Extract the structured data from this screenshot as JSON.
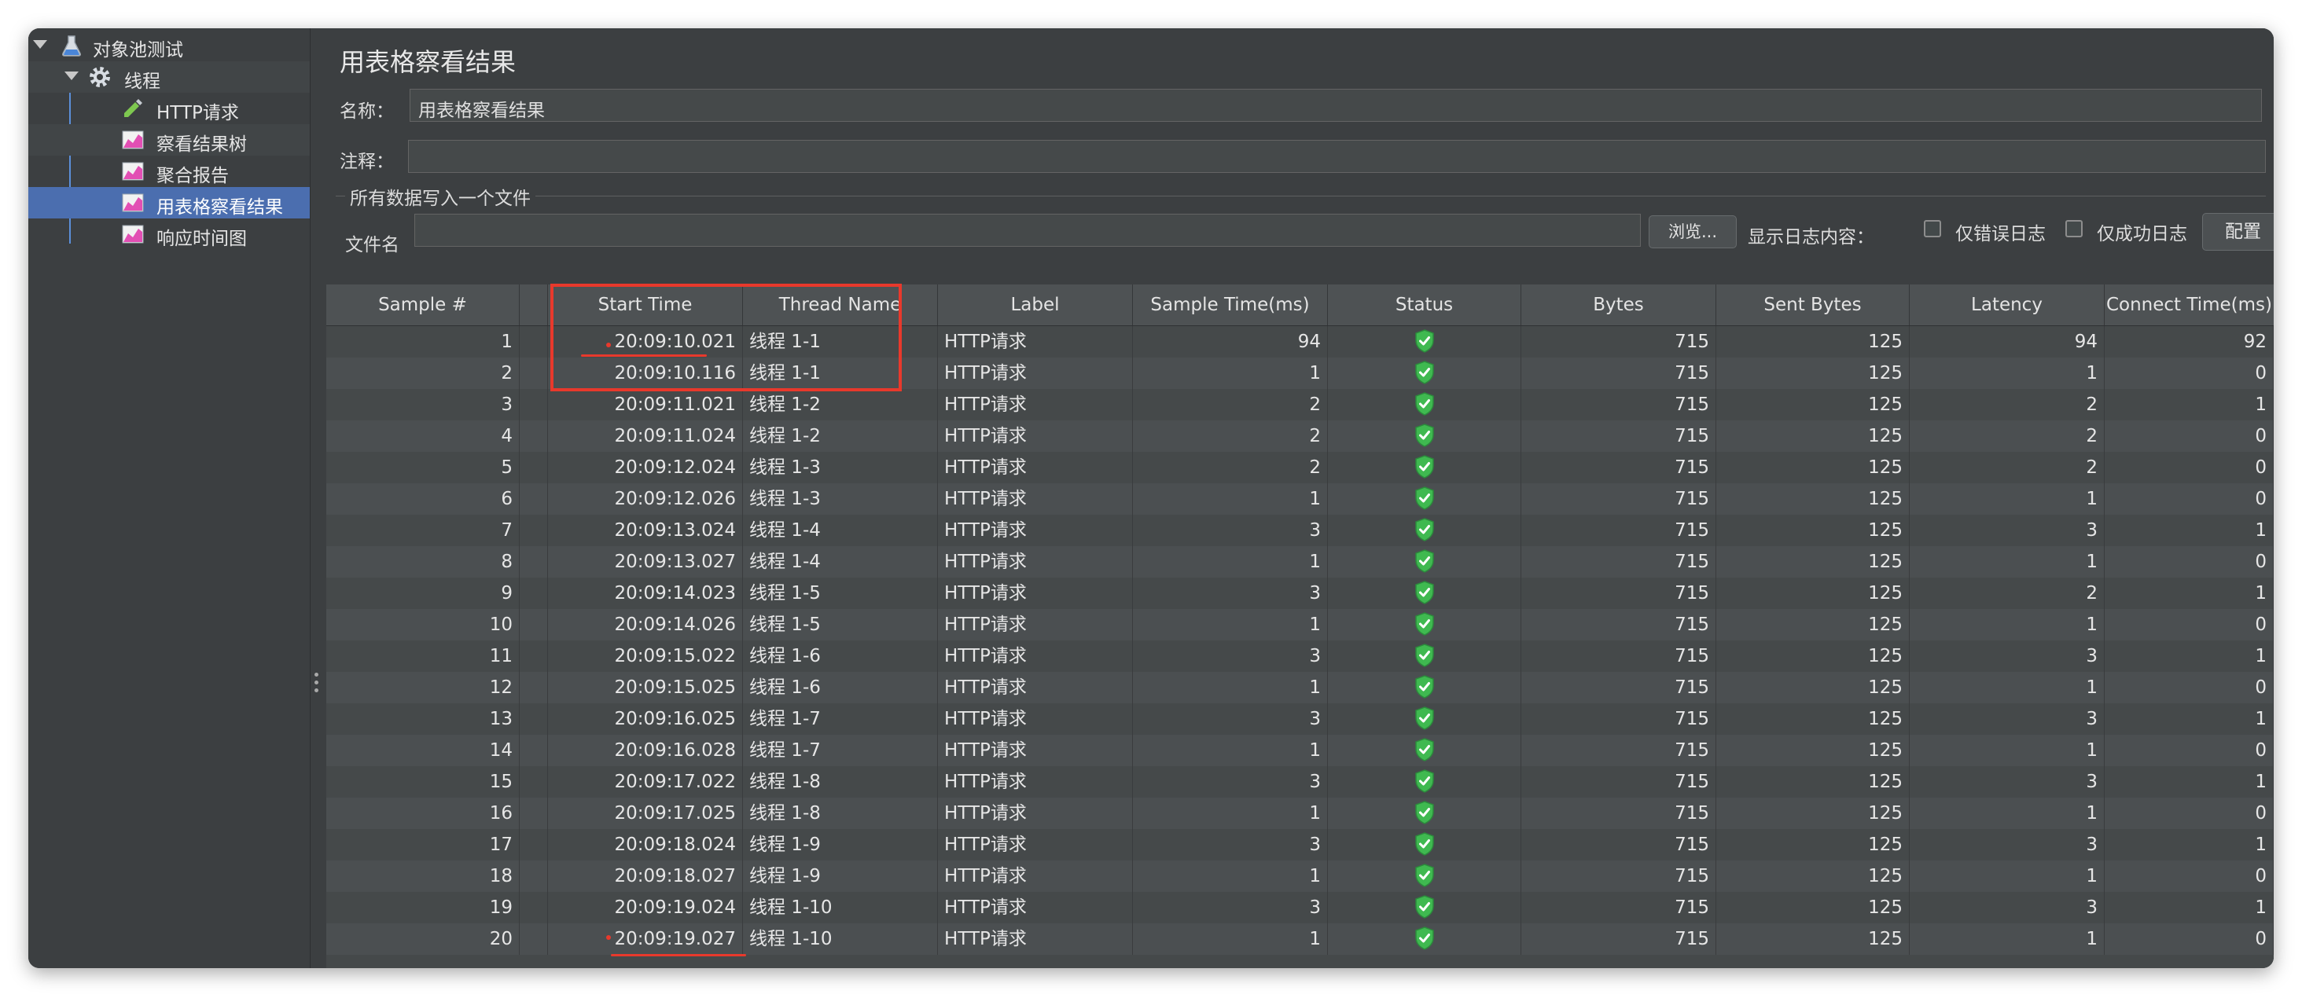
{
  "sidebar": {
    "items": [
      {
        "label": "对象池测试",
        "icon": "flask-icon"
      },
      {
        "label": "线程",
        "icon": "gear-icon"
      },
      {
        "label": "HTTP请求",
        "icon": "pipette-icon"
      },
      {
        "label": "察看结果树",
        "icon": "chart-icon"
      },
      {
        "label": "聚合报告",
        "icon": "chart-icon"
      },
      {
        "label": "用表格察看结果",
        "icon": "chart-icon"
      },
      {
        "label": "响应时间图",
        "icon": "chart-icon"
      }
    ]
  },
  "panel": {
    "title": "用表格察看结果",
    "name_label": "名称：",
    "name_value": "用表格察看结果",
    "comment_label": "注释：",
    "comment_value": "",
    "group_title": "所有数据写入一个文件",
    "filename_label": "文件名",
    "filename_value": "",
    "browse_button": "浏览...",
    "log_content_label": "显示日志内容：",
    "errors_only_label": "仅错误日志",
    "success_only_label": "仅成功日志",
    "configure_button": "配置"
  },
  "table": {
    "columns": [
      "Sample #",
      "Start Time",
      "Thread Name",
      "Label",
      "Sample Time(ms)",
      "Status",
      "Bytes",
      "Sent Bytes",
      "Latency",
      "Connect Time(ms)"
    ],
    "rows": [
      {
        "sample": "1",
        "start": "20:09:10.021",
        "thread": "线程 1-1",
        "label": "HTTP请求",
        "time": "94",
        "status": "success",
        "bytes": "715",
        "sent": "125",
        "latency": "94",
        "connect": "92"
      },
      {
        "sample": "2",
        "start": "20:09:10.116",
        "thread": "线程 1-1",
        "label": "HTTP请求",
        "time": "1",
        "status": "success",
        "bytes": "715",
        "sent": "125",
        "latency": "1",
        "connect": "0"
      },
      {
        "sample": "3",
        "start": "20:09:11.021",
        "thread": "线程 1-2",
        "label": "HTTP请求",
        "time": "2",
        "status": "success",
        "bytes": "715",
        "sent": "125",
        "latency": "2",
        "connect": "1"
      },
      {
        "sample": "4",
        "start": "20:09:11.024",
        "thread": "线程 1-2",
        "label": "HTTP请求",
        "time": "2",
        "status": "success",
        "bytes": "715",
        "sent": "125",
        "latency": "2",
        "connect": "0"
      },
      {
        "sample": "5",
        "start": "20:09:12.024",
        "thread": "线程 1-3",
        "label": "HTTP请求",
        "time": "2",
        "status": "success",
        "bytes": "715",
        "sent": "125",
        "latency": "2",
        "connect": "0"
      },
      {
        "sample": "6",
        "start": "20:09:12.026",
        "thread": "线程 1-3",
        "label": "HTTP请求",
        "time": "1",
        "status": "success",
        "bytes": "715",
        "sent": "125",
        "latency": "1",
        "connect": "0"
      },
      {
        "sample": "7",
        "start": "20:09:13.024",
        "thread": "线程 1-4",
        "label": "HTTP请求",
        "time": "3",
        "status": "success",
        "bytes": "715",
        "sent": "125",
        "latency": "3",
        "connect": "1"
      },
      {
        "sample": "8",
        "start": "20:09:13.027",
        "thread": "线程 1-4",
        "label": "HTTP请求",
        "time": "1",
        "status": "success",
        "bytes": "715",
        "sent": "125",
        "latency": "1",
        "connect": "0"
      },
      {
        "sample": "9",
        "start": "20:09:14.023",
        "thread": "线程 1-5",
        "label": "HTTP请求",
        "time": "3",
        "status": "success",
        "bytes": "715",
        "sent": "125",
        "latency": "2",
        "connect": "1"
      },
      {
        "sample": "10",
        "start": "20:09:14.026",
        "thread": "线程 1-5",
        "label": "HTTP请求",
        "time": "1",
        "status": "success",
        "bytes": "715",
        "sent": "125",
        "latency": "1",
        "connect": "0"
      },
      {
        "sample": "11",
        "start": "20:09:15.022",
        "thread": "线程 1-6",
        "label": "HTTP请求",
        "time": "3",
        "status": "success",
        "bytes": "715",
        "sent": "125",
        "latency": "3",
        "connect": "1"
      },
      {
        "sample": "12",
        "start": "20:09:15.025",
        "thread": "线程 1-6",
        "label": "HTTP请求",
        "time": "1",
        "status": "success",
        "bytes": "715",
        "sent": "125",
        "latency": "1",
        "connect": "0"
      },
      {
        "sample": "13",
        "start": "20:09:16.025",
        "thread": "线程 1-7",
        "label": "HTTP请求",
        "time": "3",
        "status": "success",
        "bytes": "715",
        "sent": "125",
        "latency": "3",
        "connect": "1"
      },
      {
        "sample": "14",
        "start": "20:09:16.028",
        "thread": "线程 1-7",
        "label": "HTTP请求",
        "time": "1",
        "status": "success",
        "bytes": "715",
        "sent": "125",
        "latency": "1",
        "connect": "0"
      },
      {
        "sample": "15",
        "start": "20:09:17.022",
        "thread": "线程 1-8",
        "label": "HTTP请求",
        "time": "3",
        "status": "success",
        "bytes": "715",
        "sent": "125",
        "latency": "3",
        "connect": "1"
      },
      {
        "sample": "16",
        "start": "20:09:17.025",
        "thread": "线程 1-8",
        "label": "HTTP请求",
        "time": "1",
        "status": "success",
        "bytes": "715",
        "sent": "125",
        "latency": "1",
        "connect": "0"
      },
      {
        "sample": "17",
        "start": "20:09:18.024",
        "thread": "线程 1-9",
        "label": "HTTP请求",
        "time": "3",
        "status": "success",
        "bytes": "715",
        "sent": "125",
        "latency": "3",
        "connect": "1"
      },
      {
        "sample": "18",
        "start": "20:09:18.027",
        "thread": "线程 1-9",
        "label": "HTTP请求",
        "time": "1",
        "status": "success",
        "bytes": "715",
        "sent": "125",
        "latency": "1",
        "connect": "0"
      },
      {
        "sample": "19",
        "start": "20:09:19.024",
        "thread": "线程 1-10",
        "label": "HTTP请求",
        "time": "3",
        "status": "success",
        "bytes": "715",
        "sent": "125",
        "latency": "3",
        "connect": "1"
      },
      {
        "sample": "20",
        "start": "20:09:19.027",
        "thread": "线程 1-10",
        "label": "HTTP请求",
        "time": "1",
        "status": "success",
        "bytes": "715",
        "sent": "125",
        "latency": "1",
        "connect": "0"
      }
    ]
  },
  "colors": {
    "annotation": "#e8392c",
    "selected": "#4b6eaf",
    "status_ok": "#3fb950"
  }
}
